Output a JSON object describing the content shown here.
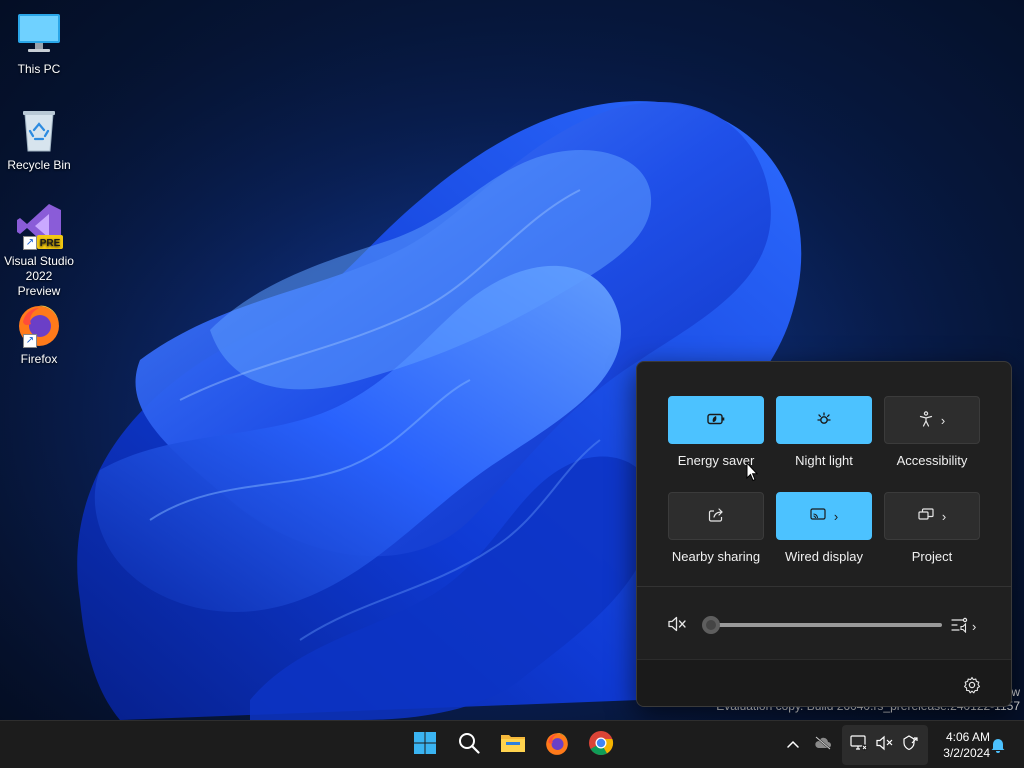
{
  "desktop": {
    "icons": [
      {
        "label": "This PC",
        "icon": "monitor-icon"
      },
      {
        "label": "Recycle Bin",
        "icon": "recycle-bin-icon"
      },
      {
        "label": "Visual Studio 2022 Preview",
        "line1": "Visual Studio",
        "line2": "2022 Preview",
        "icon": "visual-studio-icon",
        "badge": "PRE"
      },
      {
        "label": "Firefox",
        "icon": "firefox-icon"
      }
    ]
  },
  "watermark": {
    "line1": "w",
    "line2": "Evaluation copy. Build 26040.rs_prerelease.240122-1157"
  },
  "quick_settings": {
    "tiles": [
      {
        "label": "Energy saver",
        "icon": "energy-saver-icon",
        "active": true,
        "has_chevron": false
      },
      {
        "label": "Night light",
        "icon": "night-light-icon",
        "active": true,
        "has_chevron": false
      },
      {
        "label": "Accessibility",
        "icon": "accessibility-icon",
        "active": false,
        "has_chevron": true
      },
      {
        "label": "Nearby sharing",
        "icon": "nearby-sharing-icon",
        "active": false,
        "has_chevron": false
      },
      {
        "label": "Wired display",
        "icon": "cast-icon",
        "active": true,
        "has_chevron": true
      },
      {
        "label": "Project",
        "icon": "project-icon",
        "active": false,
        "has_chevron": true
      }
    ],
    "volume": {
      "level": 0,
      "muted": true,
      "icon": "speaker-muted-icon"
    },
    "accent_color": "#4cc2ff",
    "chevron": "›"
  },
  "taskbar": {
    "apps": [
      "start-icon",
      "search-icon",
      "file-explorer-icon",
      "firefox-icon",
      "chrome-icon"
    ],
    "tray": [
      "chevron-up-icon",
      "cloud-offline-icon",
      "network-disconnected-icon",
      "volume-muted-icon",
      "defender-icon"
    ],
    "time": "4:06 AM",
    "date": "3/2/2024"
  }
}
